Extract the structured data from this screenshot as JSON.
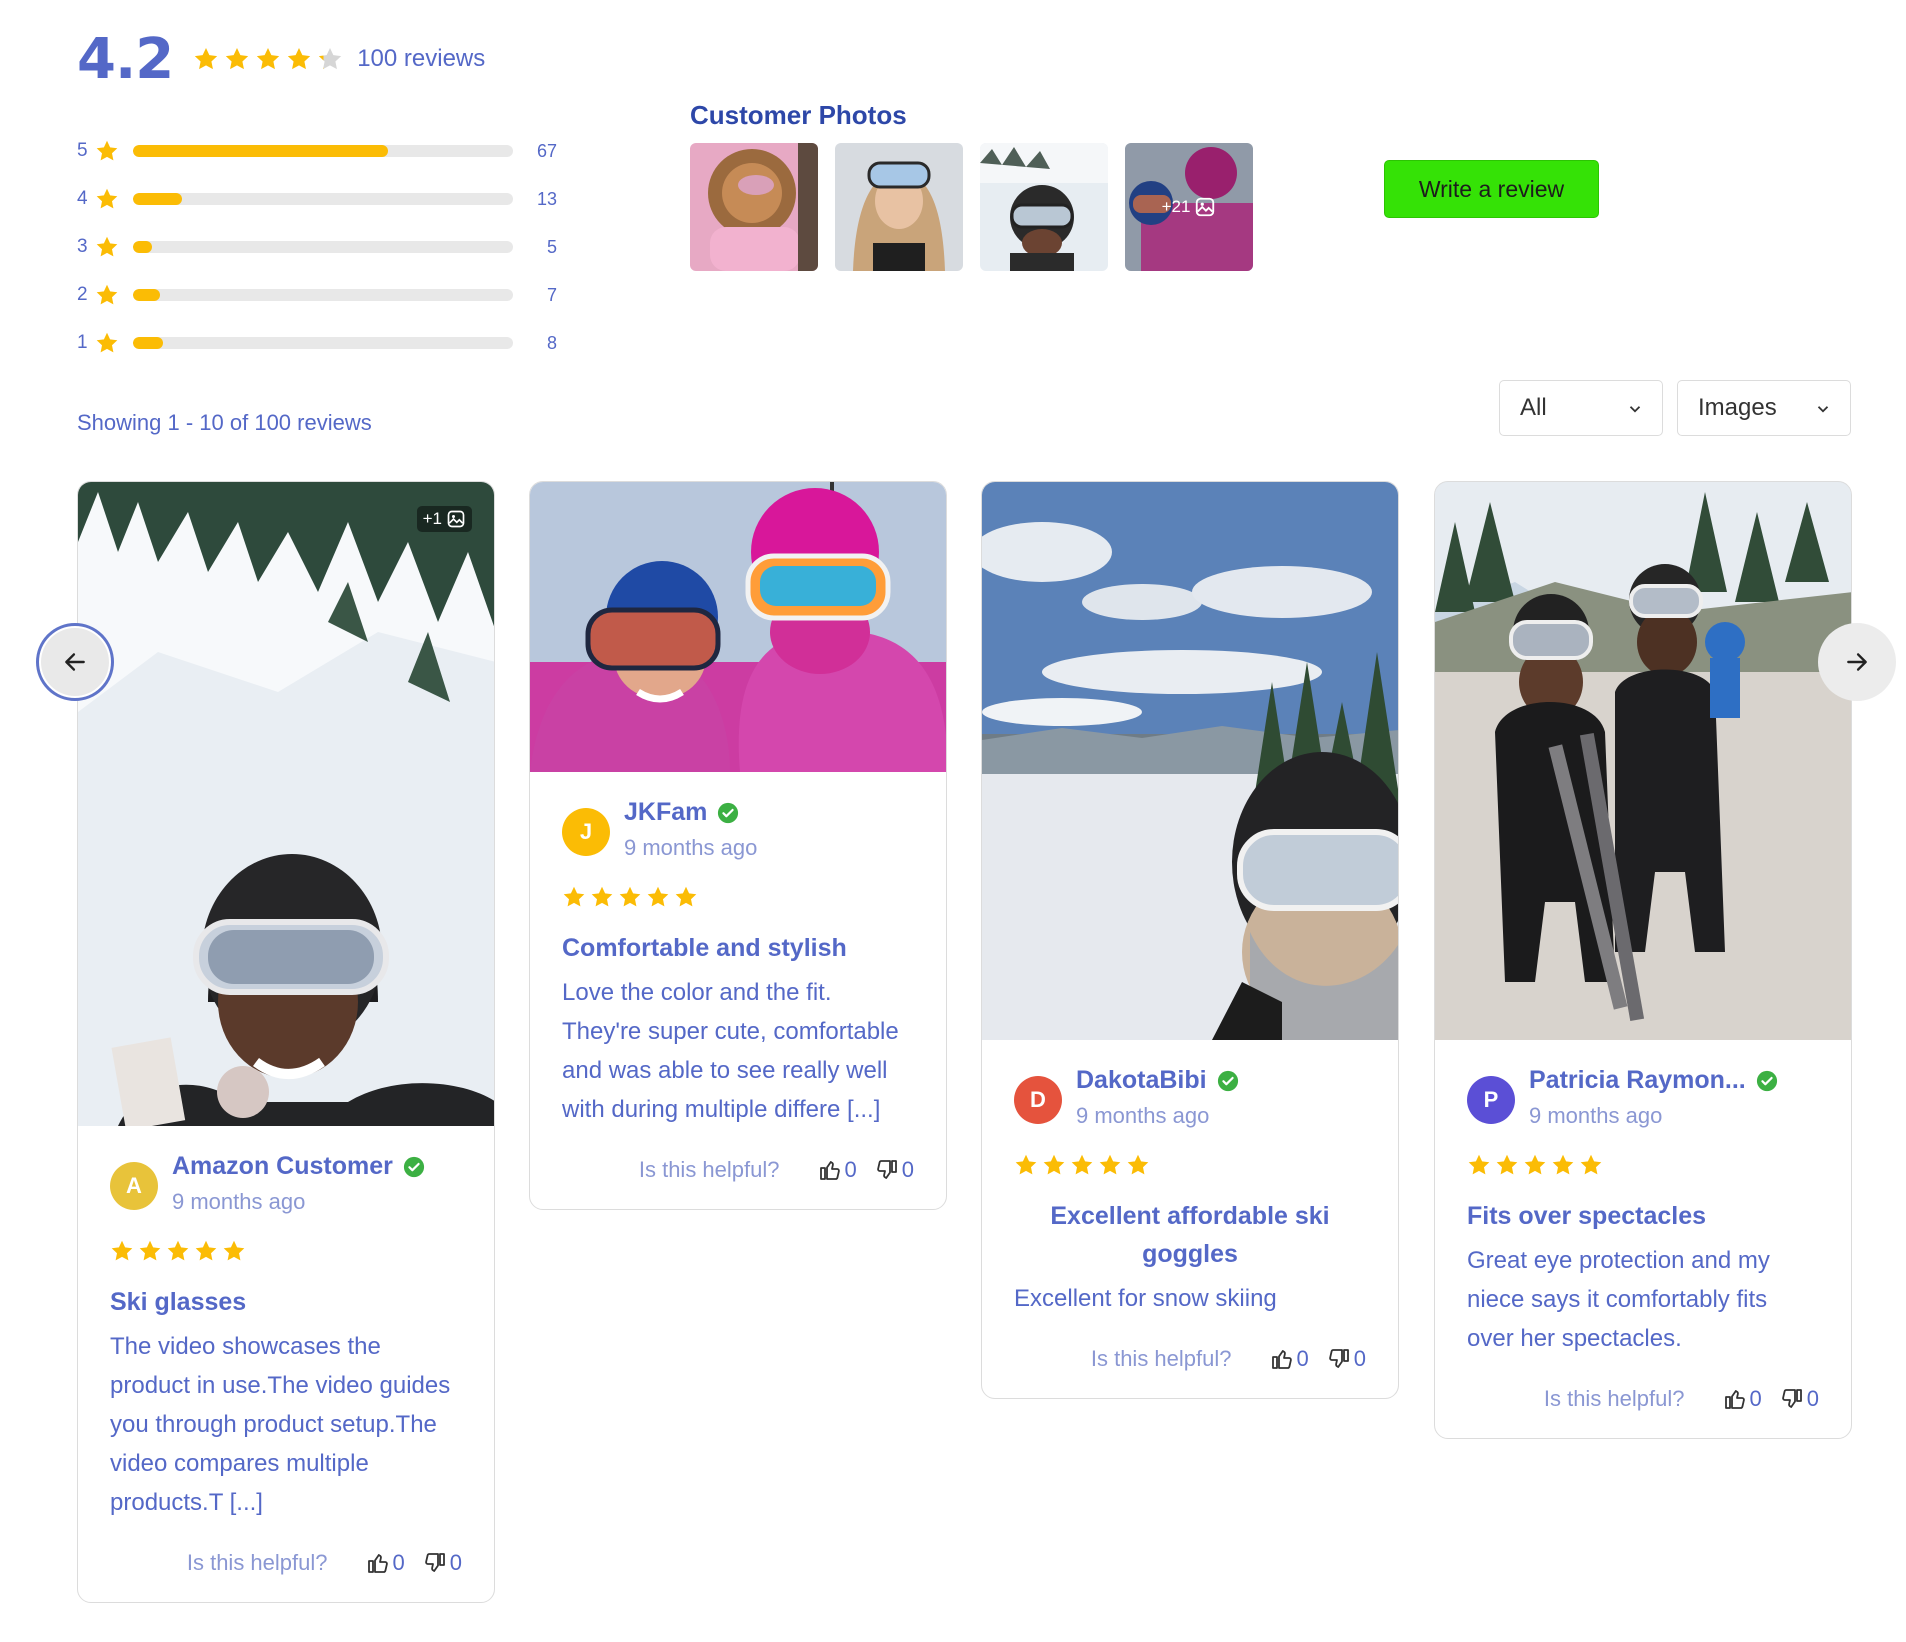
{
  "summary": {
    "average": "4.2",
    "average_value": 4.2,
    "reviews_label": "100 reviews"
  },
  "distribution": [
    {
      "stars": "5",
      "count": "67",
      "fraction": 0.67
    },
    {
      "stars": "4",
      "count": "13",
      "fraction": 0.13
    },
    {
      "stars": "3",
      "count": "5",
      "fraction": 0.05
    },
    {
      "stars": "2",
      "count": "7",
      "fraction": 0.07
    },
    {
      "stars": "1",
      "count": "8",
      "fraction": 0.08
    }
  ],
  "customer_photos": {
    "title": "Customer Photos",
    "more_label": "+21"
  },
  "write_review_label": "Write a review",
  "showing_label": "Showing 1 - 10 of 100 reviews",
  "filters": {
    "rating_selected": "All",
    "media_selected": "Images"
  },
  "helpful_label": "Is this helpful?",
  "reviews": [
    {
      "initial": "A",
      "avatar_color": "#e8c33a",
      "name": "Amazon Customer",
      "time": "9 months ago",
      "rating": 5,
      "title": "Ski glasses",
      "text": "The video showcases the product in use.The video guides you through product setup.The video compares multiple products.T [...]",
      "photo_badge": "+1",
      "up": "0",
      "down": "0"
    },
    {
      "initial": "J",
      "avatar_color": "#fbbc05",
      "name": "JKFam",
      "time": "9 months ago",
      "rating": 5,
      "title": "Comfortable and stylish",
      "text": "Love the color and the fit. They're super cute, comfortable and was able to see really well with during multiple differe [...]",
      "up": "0",
      "down": "0"
    },
    {
      "initial": "D",
      "avatar_color": "#e5533d",
      "name": "DakotaBibi",
      "time": "9 months ago",
      "rating": 5,
      "title": "Excellent affordable ski goggles",
      "text": "Excellent for snow skiing",
      "up": "0",
      "down": "0"
    },
    {
      "initial": "P",
      "avatar_color": "#5b4fd6",
      "name": "Patricia Raymon...",
      "time": "9 months ago",
      "rating": 5,
      "title": "Fits over spectacles",
      "text": "Great eye protection and my niece says it comfortably fits over her spectacles.",
      "up": "0",
      "down": "0"
    }
  ],
  "colors": {
    "accent_text": "#5468c7",
    "star": "#fbbc05",
    "write_button": "#35e206",
    "verified": "#3cb043"
  },
  "icons": [
    "star-icon",
    "verified-check-icon",
    "thumbs-up-icon",
    "thumbs-down-icon",
    "image-icon",
    "chevron-down-icon",
    "arrow-left-icon",
    "arrow-right-icon"
  ]
}
